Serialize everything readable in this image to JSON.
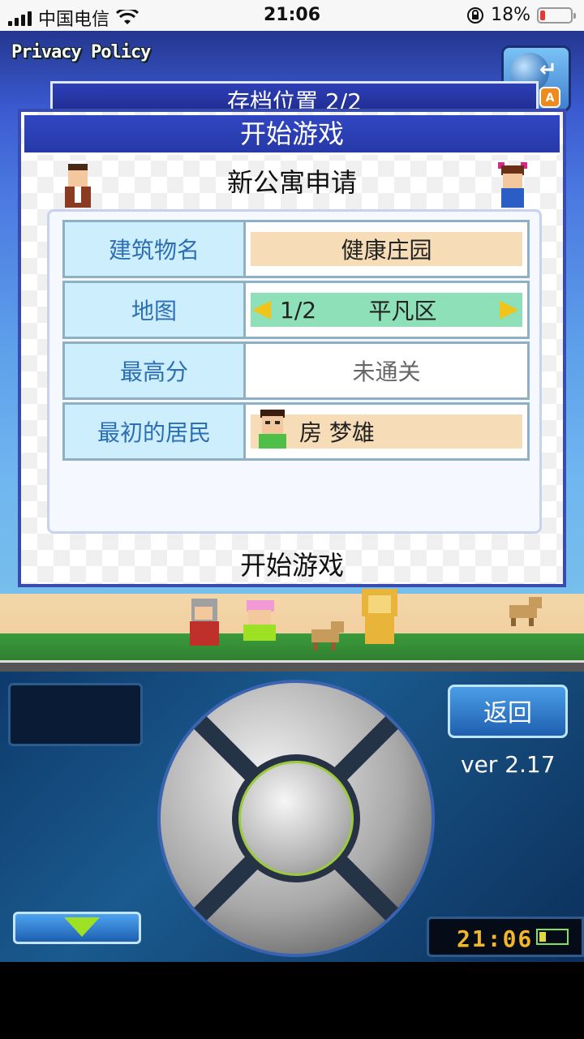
{
  "status_bar": {
    "carrier": "中国电信",
    "time": "21:06",
    "battery_percent": "18%",
    "battery_level": 0.18
  },
  "game": {
    "privacy_link": "Privacy Policy",
    "background_panel_title": "存档位置 2/2",
    "dialog": {
      "title": "开始游戏",
      "subtitle": "新公寓申请",
      "rows": [
        {
          "label": "建筑物名",
          "value": "健康庄园"
        },
        {
          "label": "地图",
          "page": "1/2",
          "value": "平凡区"
        },
        {
          "label": "最高分",
          "value": "未通关"
        },
        {
          "label": "最初的居民",
          "value": "房 梦雄"
        }
      ],
      "start_button": "开始游戏"
    }
  },
  "controls": {
    "back_button": "返回",
    "version": "ver 2.17",
    "clock": "21:06"
  },
  "colors": {
    "title_bar": "#2739a8",
    "label_cell": "#cdeefc",
    "label_text": "#2c6fb5",
    "value_chip": "#f6ddb8",
    "map_chip": "#8ee0b8"
  }
}
